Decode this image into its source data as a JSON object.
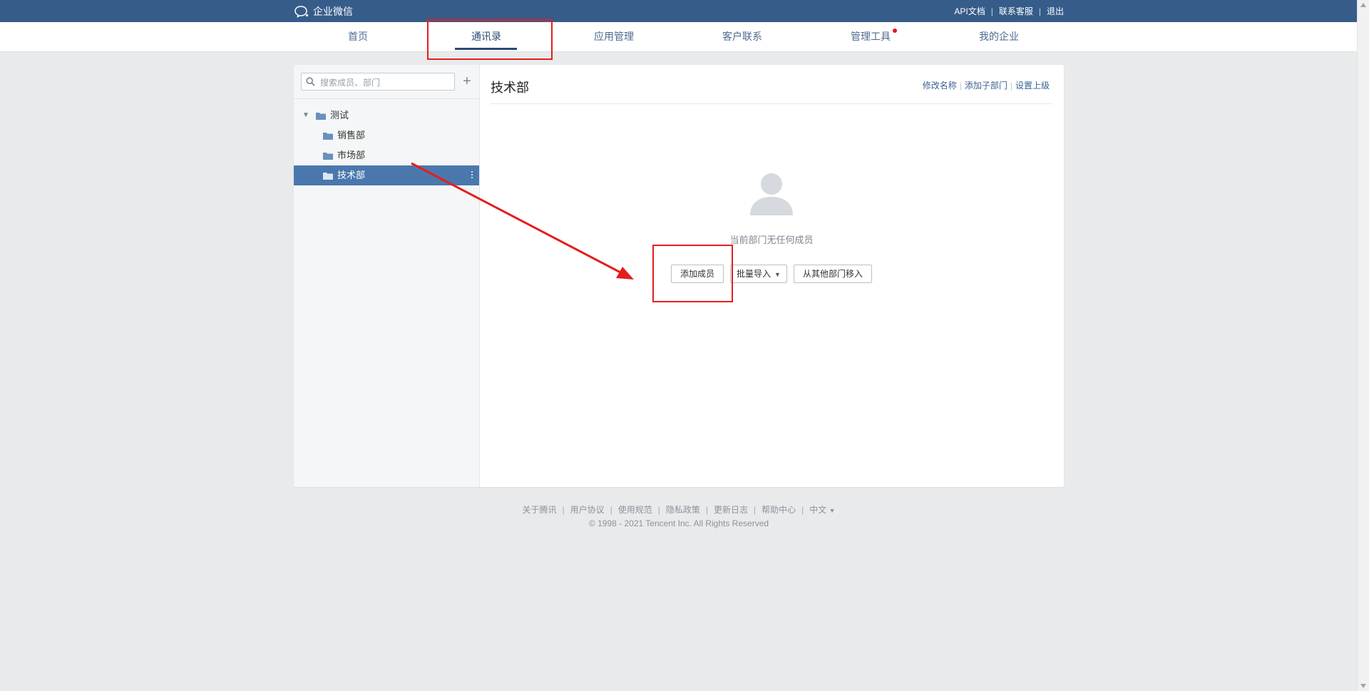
{
  "topbar": {
    "brand": "企业微信",
    "links": [
      "API文档",
      "联系客服",
      "退出"
    ]
  },
  "nav": {
    "items": [
      "首页",
      "通讯录",
      "应用管理",
      "客户联系",
      "管理工具",
      "我的企业"
    ],
    "active": "通讯录"
  },
  "sidebar": {
    "search_placeholder": "搜索成员、部门",
    "tree": {
      "root": "测试",
      "children": [
        "销售部",
        "市场部",
        "技术部"
      ],
      "selected": "技术部"
    }
  },
  "main": {
    "dept_title": "技术部",
    "actions": [
      "修改名称",
      "添加子部门",
      "设置上级"
    ],
    "empty_text": "当前部门无任何成员",
    "buttons": {
      "add_member": "添加成员",
      "batch_import": "批量导入",
      "move_from_other": "从其他部门移入"
    }
  },
  "footer": {
    "links": [
      "关于腾讯",
      "用户协议",
      "使用规范",
      "隐私政策",
      "更新日志",
      "帮助中心",
      "中文"
    ],
    "copyright": "© 1998 - 2021 Tencent Inc. All Rights Reserved"
  },
  "colors": {
    "topbar": "#365c8a",
    "nav_text": "#4f6a8f",
    "selected_row": "#4a78ad",
    "annotation": "#e41e1e",
    "notification_dot": "#e0141d"
  }
}
